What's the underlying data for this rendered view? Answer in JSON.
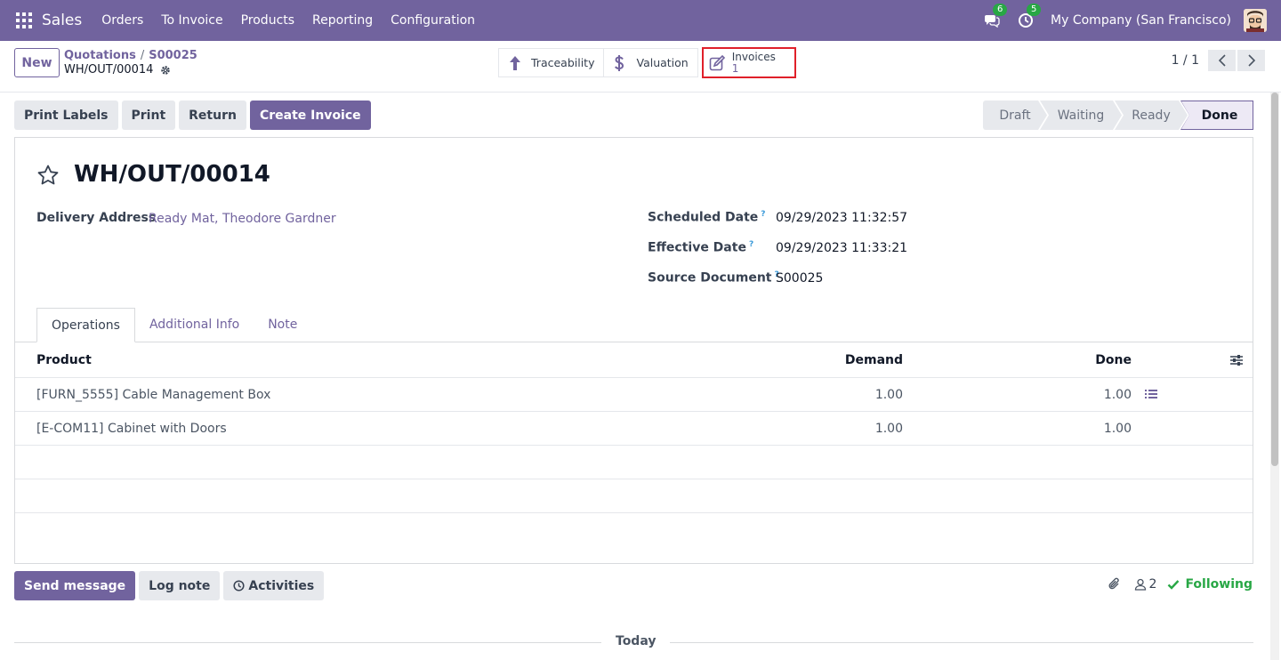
{
  "navbar": {
    "app_name": "Sales",
    "menu": [
      "Orders",
      "To Invoice",
      "Products",
      "Reporting",
      "Configuration"
    ],
    "messages_count": "6",
    "activities_count": "5",
    "company": "My Company (San Francisco)"
  },
  "control": {
    "new_label": "New",
    "breadcrumb": [
      "Quotations",
      "S00025"
    ],
    "breadcrumb_sep": "/",
    "record_name": "WH/OUT/00014",
    "smart_buttons": {
      "traceability": "Traceability",
      "valuation": "Valuation",
      "invoices_label": "Invoices",
      "invoices_count": "1"
    },
    "pager": "1 / 1"
  },
  "actions": {
    "print_labels": "Print Labels",
    "print": "Print",
    "return": "Return",
    "create_invoice": "Create Invoice"
  },
  "status": {
    "stages": [
      "Draft",
      "Waiting",
      "Ready",
      "Done"
    ],
    "active": "Done"
  },
  "form": {
    "title": "WH/OUT/00014",
    "delivery_address_label": "Delivery Address",
    "delivery_address_value": "Ready Mat, Theodore Gardner",
    "scheduled_date_label": "Scheduled Date",
    "scheduled_date_value": "09/29/2023 11:32:57",
    "effective_date_label": "Effective Date",
    "effective_date_value": "09/29/2023 11:33:21",
    "source_document_label": "Source Document",
    "source_document_value": "S00025",
    "help_mark": "?"
  },
  "tabs": [
    "Operations",
    "Additional Info",
    "Note"
  ],
  "operations": {
    "columns": {
      "product": "Product",
      "demand": "Demand",
      "done": "Done"
    },
    "rows": [
      {
        "product": "[FURN_5555] Cable Management Box",
        "demand": "1.00",
        "done": "1.00"
      },
      {
        "product": "[E-COM11] Cabinet with Doors",
        "demand": "1.00",
        "done": "1.00"
      }
    ]
  },
  "chatter": {
    "send_message": "Send message",
    "log_note": "Log note",
    "activities": "Activities",
    "followers_count": "2",
    "following": "Following",
    "today": "Today"
  },
  "colors": {
    "brand": "#71639e",
    "highlight_border": "#e0202a",
    "success": "#28a745"
  }
}
